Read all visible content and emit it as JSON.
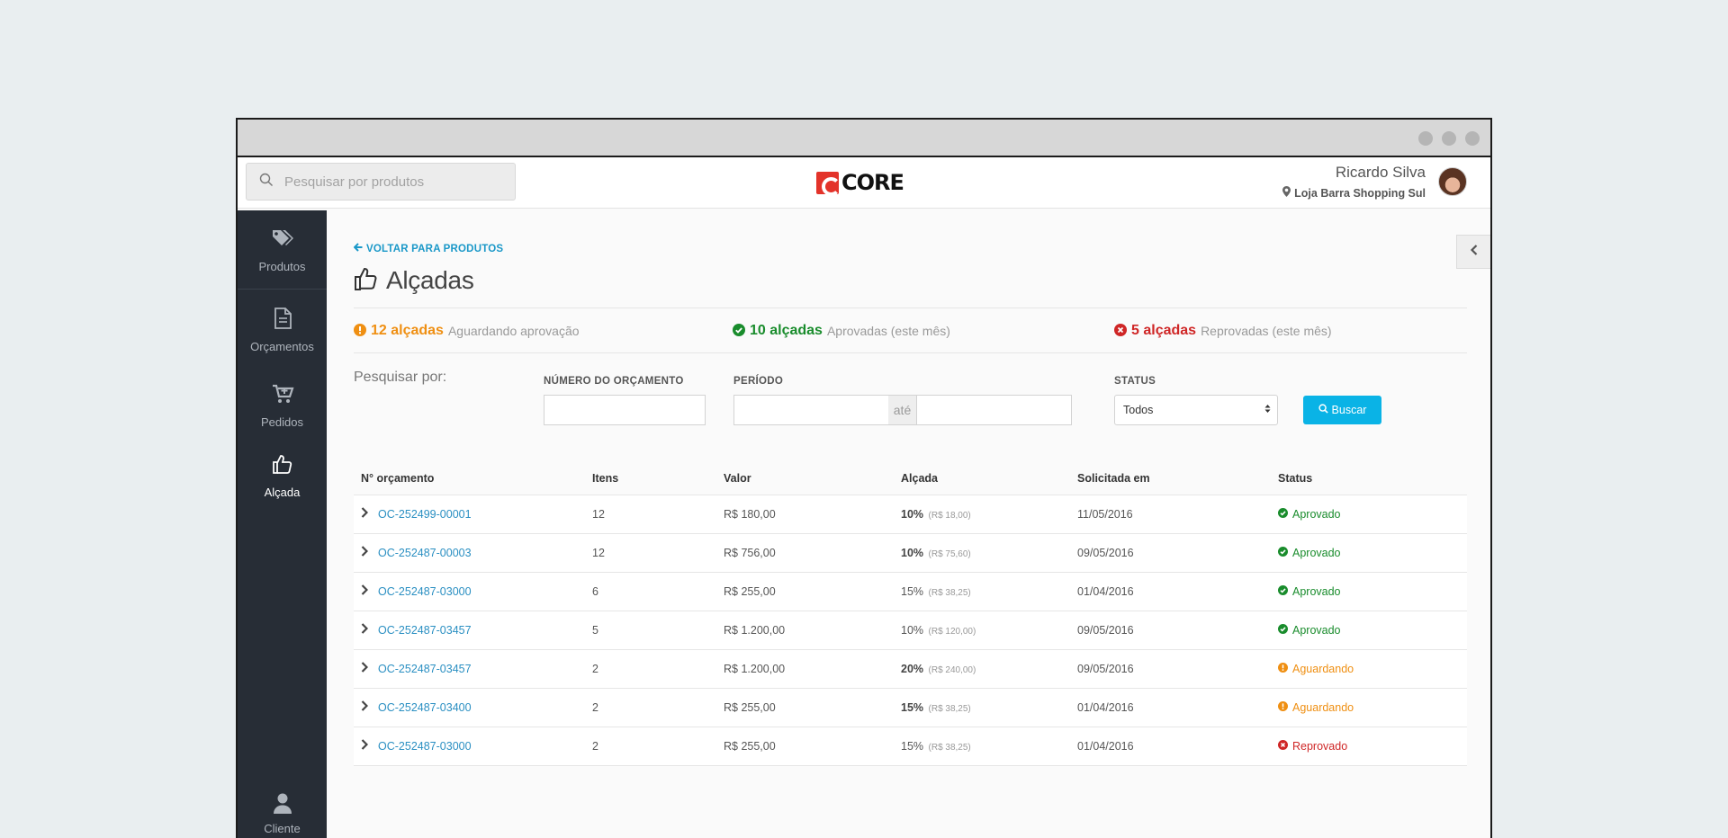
{
  "search": {
    "placeholder": "Pesquisar por produtos"
  },
  "brand": {
    "logo_text": "CORE",
    "color": "#e3332a"
  },
  "user": {
    "name": "Ricardo Silva",
    "store": "Loja Barra Shopping Sul"
  },
  "sidebar": {
    "items": [
      {
        "label": "Produtos",
        "icon": "tags-icon"
      },
      {
        "label": "Orçamentos",
        "icon": "document-icon"
      },
      {
        "label": "Pedidos",
        "icon": "cart-icon"
      },
      {
        "label": "Alçada",
        "icon": "thumbs-up-icon",
        "active": true
      }
    ],
    "bottom": {
      "label": "Cliente",
      "icon": "user-icon"
    }
  },
  "page": {
    "back_label": "VOLTAR PARA PRODUTOS",
    "title": "Alçadas"
  },
  "stats": {
    "pending": {
      "count": "12 alçadas",
      "label": "Aguardando aprovação",
      "color": "#ef8f12"
    },
    "approved": {
      "count": "10 alçadas",
      "label": "Aprovadas (este mês)",
      "color": "#198c2c"
    },
    "rejected": {
      "count": "5 alçadas",
      "label": "Reprovadas (este mês)",
      "color": "#cf2626"
    }
  },
  "filters": {
    "title": "Pesquisar por:",
    "numero_label": "NÚMERO DO ORÇAMENTO",
    "numero_value": "",
    "periodo_label": "PERÍODO",
    "periodo_from": "",
    "periodo_sep": "até",
    "periodo_to": "",
    "status_label": "STATUS",
    "status_value": "Todos",
    "button_label": "Buscar"
  },
  "table": {
    "headers": [
      "N° orçamento",
      "Itens",
      "Valor",
      "Alçada",
      "Solicitada em",
      "Status"
    ],
    "rows": [
      {
        "id": "OC-252499-00001",
        "itens": "12",
        "valor": "R$ 180,00",
        "pct": "10%",
        "pct_bold": true,
        "amount": "(R$ 18,00)",
        "date": "11/05/2016",
        "status": "Aprovado",
        "kind": "ok"
      },
      {
        "id": "OC-252487-00003",
        "itens": "12",
        "valor": "R$ 756,00",
        "pct": "10%",
        "pct_bold": true,
        "amount": "(R$ 75,60)",
        "date": "09/05/2016",
        "status": "Aprovado",
        "kind": "ok"
      },
      {
        "id": "OC-252487-03000",
        "itens": "6",
        "valor": "R$ 255,00",
        "pct": "15%",
        "pct_bold": false,
        "amount": "(R$ 38,25)",
        "date": "01/04/2016",
        "status": "Aprovado",
        "kind": "ok"
      },
      {
        "id": "OC-252487-03457",
        "itens": "5",
        "valor": "R$ 1.200,00",
        "pct": "10%",
        "pct_bold": false,
        "amount": "(R$ 120,00)",
        "date": "09/05/2016",
        "status": "Aprovado",
        "kind": "ok"
      },
      {
        "id": "OC-252487-03457",
        "itens": "2",
        "valor": "R$ 1.200,00",
        "pct": "20%",
        "pct_bold": true,
        "amount": "(R$ 240,00)",
        "date": "09/05/2016",
        "status": "Aguardando",
        "kind": "wait"
      },
      {
        "id": "OC-252487-03400",
        "itens": "2",
        "valor": "R$ 255,00",
        "pct": "15%",
        "pct_bold": true,
        "amount": "(R$ 38,25)",
        "date": "01/04/2016",
        "status": "Aguardando",
        "kind": "wait"
      },
      {
        "id": "OC-252487-03000",
        "itens": "2",
        "valor": "R$ 255,00",
        "pct": "15%",
        "pct_bold": false,
        "amount": "(R$ 38,25)",
        "date": "01/04/2016",
        "status": "Reprovado",
        "kind": "fail"
      }
    ]
  },
  "colors": {
    "link": "#2a8fc2",
    "button": "#0ab3e6",
    "sidebar": "#272d36",
    "ok": "#198c2c",
    "wait": "#ef8f12",
    "fail": "#cf2626"
  }
}
